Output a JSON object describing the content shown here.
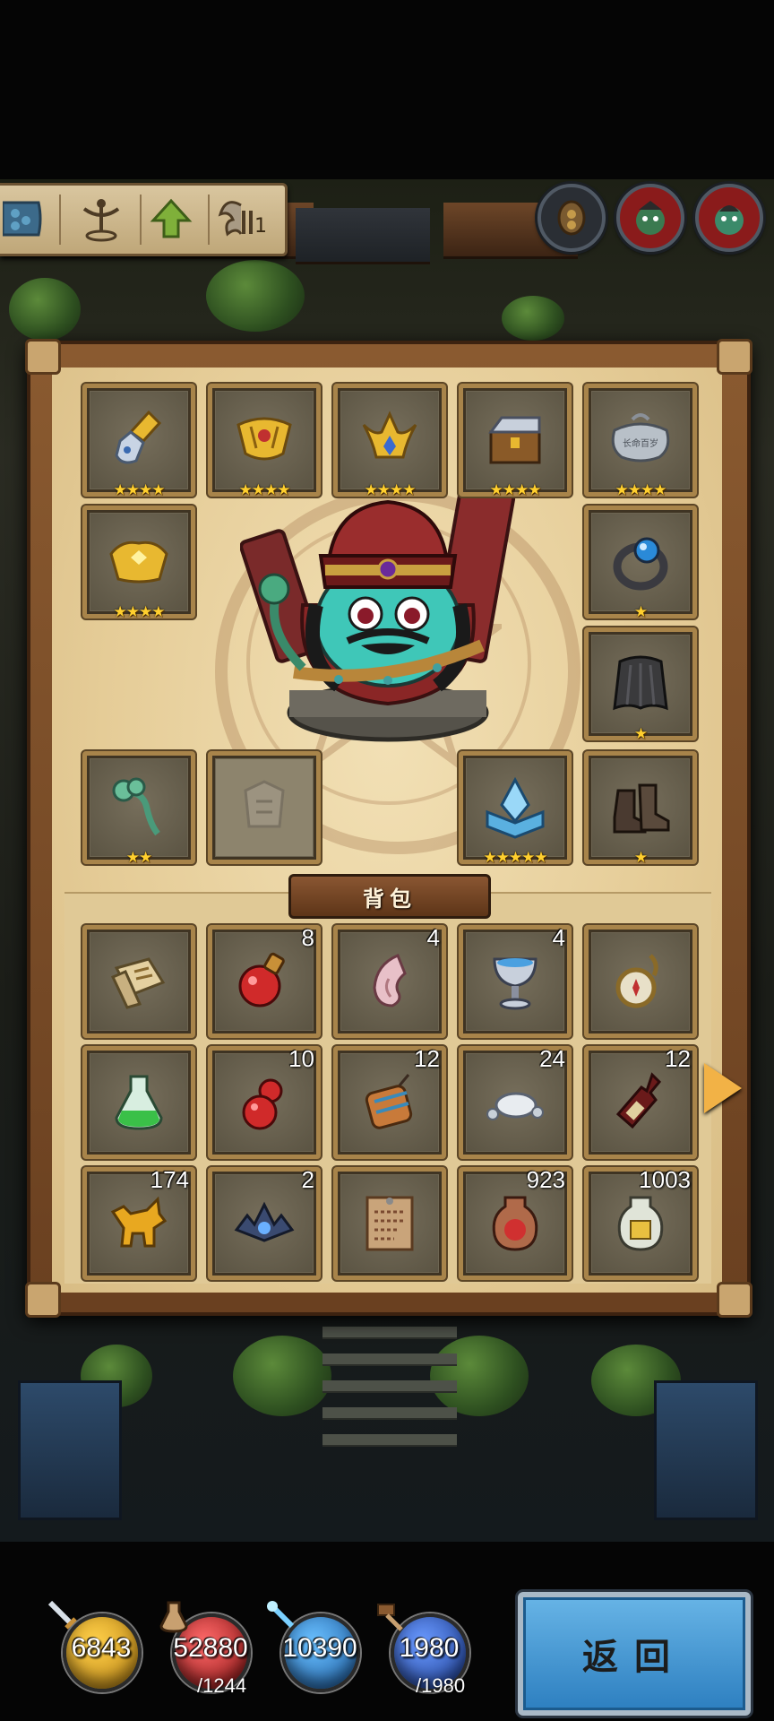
{
  "toolbar": {
    "icons": [
      "shield-pattern-icon",
      "totem-icon",
      "upgrade-arrow-icon",
      "wings-icon"
    ],
    "wings_badge": "1"
  },
  "top_buttons": {
    "items": [
      {
        "name": "coin-medal-icon",
        "ring_color": "#2a2e34",
        "inner": "#7a5a30"
      },
      {
        "name": "green-hero-portrait-1-icon",
        "ring_color": "#8a1b1b",
        "inner": "#3b7a50"
      },
      {
        "name": "green-hero-portrait-2-icon",
        "ring_color": "#8a1b1b",
        "inner": "#3b7a50"
      }
    ]
  },
  "equipment": {
    "slots": [
      {
        "name": "gauntlet-icon",
        "stars": "★★★★"
      },
      {
        "name": "golden-armor-icon",
        "stars": "★★★★"
      },
      {
        "name": "golden-crown-icon",
        "stars": "★★★★"
      },
      {
        "name": "treasure-chest-icon",
        "stars": "★★★★"
      },
      {
        "name": "silver-lock-amulet-icon",
        "stars": "★★★★"
      },
      {
        "name": "golden-shoulder-armor-icon",
        "stars": "★★★★"
      },
      {
        "name": "sapphire-ring-icon",
        "stars": "★"
      },
      {
        "name": "dark-cape-icon",
        "stars": "★"
      },
      {
        "name": "jade-ruyi-icon",
        "stars": "★★"
      },
      {
        "name": "empty-slot-icon",
        "stars": ""
      },
      {
        "name": "crystal-book-icon",
        "stars": "★★★★★"
      },
      {
        "name": "leather-boots-icon",
        "stars": "★"
      }
    ]
  },
  "bag": {
    "title": "背包",
    "items": [
      {
        "name": "scroll-map-icon",
        "qty": ""
      },
      {
        "name": "red-potion-icon",
        "qty": "8"
      },
      {
        "name": "pointed-ear-icon",
        "qty": "4"
      },
      {
        "name": "silver-chalice-icon",
        "qty": "4"
      },
      {
        "name": "pocket-compass-icon",
        "qty": ""
      },
      {
        "name": "green-flask-icon",
        "qty": ""
      },
      {
        "name": "red-gourd-icon",
        "qty": "10"
      },
      {
        "name": "lantern-drum-icon",
        "qty": "12"
      },
      {
        "name": "silver-ingot-icon",
        "qty": "24"
      },
      {
        "name": "wine-bottle-icon",
        "qty": "12"
      },
      {
        "name": "golden-beast-icon",
        "qty": "174"
      },
      {
        "name": "spiked-gem-icon",
        "qty": "2"
      },
      {
        "name": "parchment-note-icon",
        "qty": ""
      },
      {
        "name": "red-jar-icon",
        "qty": "923"
      },
      {
        "name": "porcelain-jar-icon",
        "qty": "1003"
      }
    ]
  },
  "resources": [
    {
      "name": "gold-resource",
      "value": "6843",
      "cap": "",
      "color": "#d8a526"
    },
    {
      "name": "red-resource",
      "value": "52880",
      "cap": "/1244",
      "color": "#b52525"
    },
    {
      "name": "blue-resource",
      "value": "10390",
      "cap": "",
      "color": "#2f7fd0"
    },
    {
      "name": "energy-resource",
      "value": "1980",
      "cap": "/1980",
      "color": "#3b6fc0"
    }
  ],
  "return_button": {
    "label": "返回"
  }
}
